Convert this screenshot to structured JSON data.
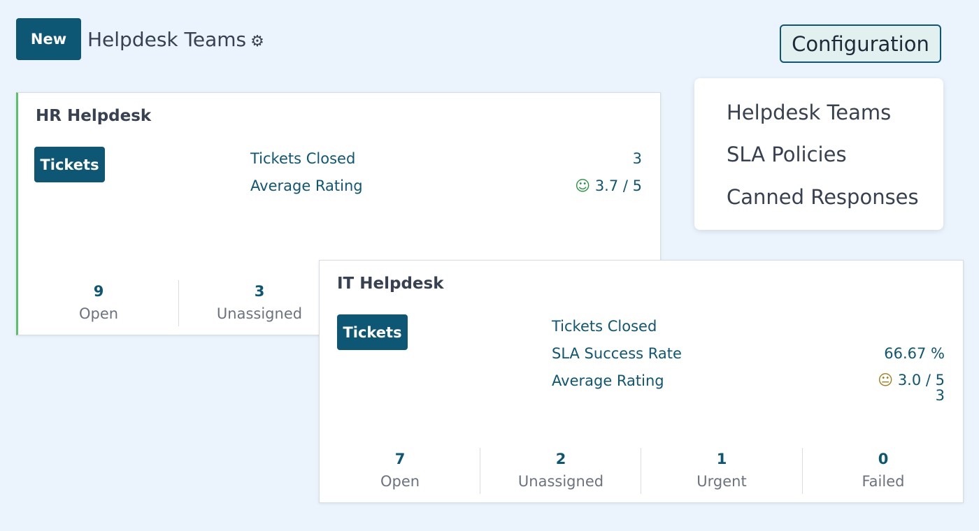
{
  "header": {
    "new_label": "New",
    "title": "Helpdesk Teams",
    "gear_icon": "gear-icon",
    "configuration_label": "Configuration"
  },
  "config_menu": [
    "Helpdesk Teams",
    "SLA Policies",
    "Canned Responses"
  ],
  "hr": {
    "name": "HR Helpdesk",
    "tickets_label": "Tickets",
    "tickets_closed_label": "Tickets Closed",
    "tickets_closed": "3",
    "avg_rating_label": "Average Rating",
    "avg_rating": "3.7 / 5",
    "rating_icon": "smile-icon",
    "rating_color": "#22963f",
    "accent": "#5cc06d",
    "stats": [
      {
        "n": "9",
        "t": "Open"
      },
      {
        "n": "3",
        "t": "Unassigned"
      }
    ]
  },
  "it": {
    "name": "IT Helpdesk",
    "tickets_label": "Tickets",
    "tickets_closed_label": "Tickets Closed",
    "tickets_closed": "3",
    "sla_label": "SLA Success Rate",
    "sla": "66.67 %",
    "avg_rating_label": "Average Rating",
    "avg_rating": "3.0 / 5",
    "rating_icon": "neutral-face-icon",
    "rating_color": "#a57c1b",
    "stats": [
      {
        "n": "7",
        "t": "Open"
      },
      {
        "n": "2",
        "t": "Unassigned"
      },
      {
        "n": "1",
        "t": "Urgent"
      },
      {
        "n": "0",
        "t": "Failed"
      }
    ]
  }
}
